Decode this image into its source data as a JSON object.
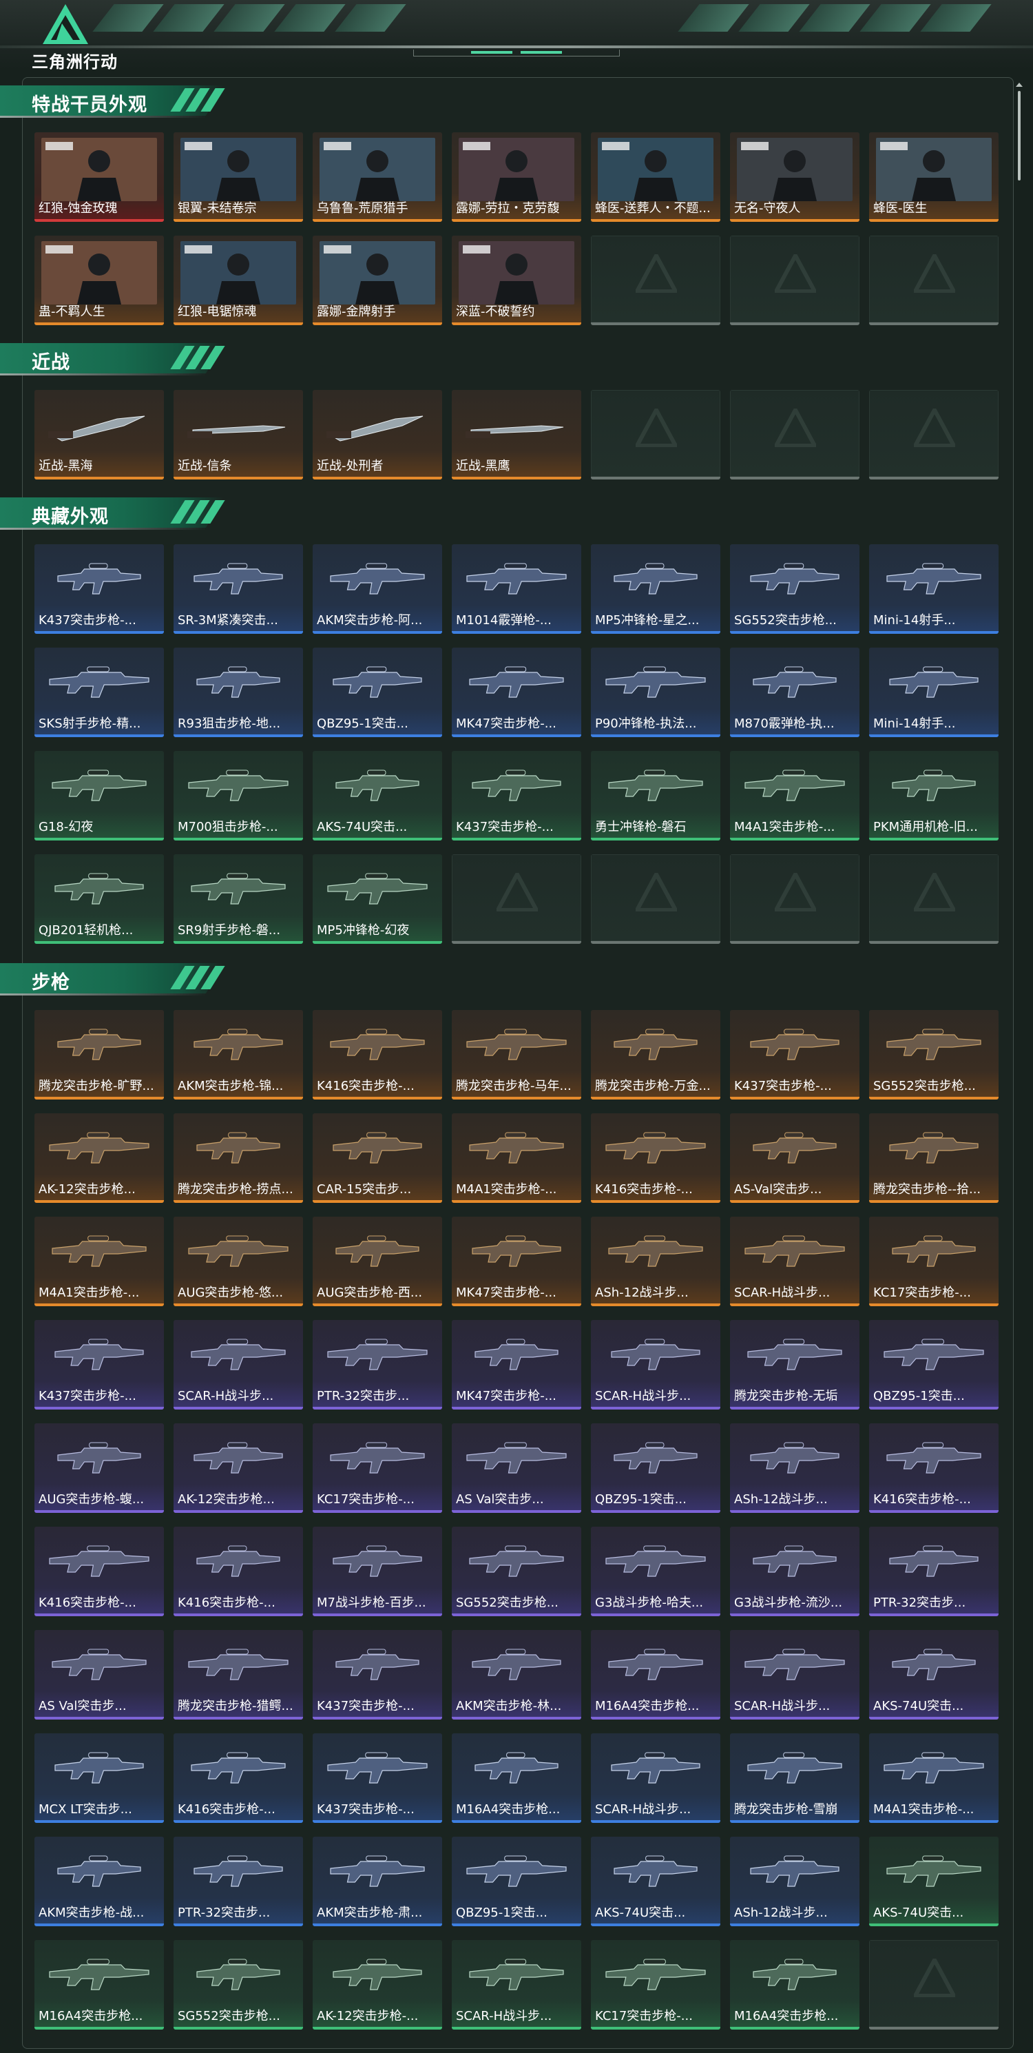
{
  "app": {
    "logo_text": "三角洲行动",
    "logo_icon": "delta-triangle-logo"
  },
  "sections": [
    {
      "title": "特战干员外观",
      "items": [
        {
          "label": "红狼-蚀金玫瑰",
          "rarity": "red",
          "kind": "portrait"
        },
        {
          "label": "银翼-未结卷宗",
          "rarity": "orange",
          "kind": "portrait"
        },
        {
          "label": "乌鲁鲁-荒原猎手",
          "rarity": "orange",
          "kind": "portrait"
        },
        {
          "label": "露娜-劳拉・克劳馥",
          "rarity": "orange",
          "kind": "portrait"
        },
        {
          "label": "蜂医-送葬人・不题...",
          "rarity": "orange",
          "kind": "portrait"
        },
        {
          "label": "无名-守夜人",
          "rarity": "orange",
          "kind": "portrait"
        },
        {
          "label": "蜂医-医生",
          "rarity": "orange",
          "kind": "portrait"
        },
        {
          "label": "蛊-不羁人生",
          "rarity": "orange",
          "kind": "portrait"
        },
        {
          "label": "红狼-电锯惊魂",
          "rarity": "orange",
          "kind": "portrait"
        },
        {
          "label": "露娜-金牌射手",
          "rarity": "orange",
          "kind": "portrait"
        },
        {
          "label": "深蓝-不破誓约",
          "rarity": "orange",
          "kind": "portrait"
        },
        {
          "label": "",
          "rarity": "empty"
        },
        {
          "label": "",
          "rarity": "empty"
        },
        {
          "label": "",
          "rarity": "empty"
        }
      ]
    },
    {
      "title": "近战",
      "items": [
        {
          "label": "近战-黑海",
          "rarity": "orange",
          "kind": "melee"
        },
        {
          "label": "近战-信条",
          "rarity": "orange",
          "kind": "melee"
        },
        {
          "label": "近战-处刑者",
          "rarity": "orange",
          "kind": "melee"
        },
        {
          "label": "近战-黑鹰",
          "rarity": "orange",
          "kind": "melee"
        },
        {
          "label": "",
          "rarity": "empty"
        },
        {
          "label": "",
          "rarity": "empty"
        },
        {
          "label": "",
          "rarity": "empty"
        }
      ]
    },
    {
      "title": "典藏外观",
      "items": [
        {
          "label": "K437突击步枪-...",
          "rarity": "blue",
          "kind": "gun"
        },
        {
          "label": "SR-3M紧凑突击...",
          "rarity": "blue",
          "kind": "gun"
        },
        {
          "label": "AKM突击步枪-阿...",
          "rarity": "blue",
          "kind": "gun"
        },
        {
          "label": "M1014霰弹枪-...",
          "rarity": "blue",
          "kind": "gun"
        },
        {
          "label": "MP5冲锋枪-星之...",
          "rarity": "blue",
          "kind": "gun"
        },
        {
          "label": "SG552突击步枪...",
          "rarity": "blue",
          "kind": "gun"
        },
        {
          "label": "Mini-14射手...",
          "rarity": "blue",
          "kind": "gun"
        },
        {
          "label": "SKS射手步枪-精...",
          "rarity": "blue",
          "kind": "gun"
        },
        {
          "label": "R93狙击步枪-地...",
          "rarity": "blue",
          "kind": "gun"
        },
        {
          "label": "QBZ95-1突击...",
          "rarity": "blue",
          "kind": "gun"
        },
        {
          "label": "MK47突击步枪-...",
          "rarity": "blue",
          "kind": "gun"
        },
        {
          "label": "P90冲锋枪-执法...",
          "rarity": "blue",
          "kind": "gun"
        },
        {
          "label": "M870霰弹枪-执...",
          "rarity": "blue",
          "kind": "gun"
        },
        {
          "label": "Mini-14射手...",
          "rarity": "blue",
          "kind": "gun"
        },
        {
          "label": "G18-幻夜",
          "rarity": "green",
          "kind": "gun"
        },
        {
          "label": "M700狙击步枪-...",
          "rarity": "green",
          "kind": "gun"
        },
        {
          "label": "AKS-74U突击...",
          "rarity": "green",
          "kind": "gun"
        },
        {
          "label": "K437突击步枪-...",
          "rarity": "green",
          "kind": "gun"
        },
        {
          "label": "勇士冲锋枪-磐石",
          "rarity": "green",
          "kind": "gun"
        },
        {
          "label": "M4A1突击步枪-...",
          "rarity": "green",
          "kind": "gun"
        },
        {
          "label": "PKM通用机枪-旧...",
          "rarity": "green",
          "kind": "gun"
        },
        {
          "label": "QJB201轻机枪...",
          "rarity": "green",
          "kind": "gun"
        },
        {
          "label": "SR9射手步枪-磐...",
          "rarity": "green",
          "kind": "gun"
        },
        {
          "label": "MP5冲锋枪-幻夜",
          "rarity": "green",
          "kind": "gun"
        },
        {
          "label": "",
          "rarity": "empty"
        },
        {
          "label": "",
          "rarity": "empty"
        },
        {
          "label": "",
          "rarity": "empty"
        },
        {
          "label": "",
          "rarity": "empty"
        }
      ]
    },
    {
      "title": "步枪",
      "items": [
        {
          "label": "腾龙突击步枪-旷野...",
          "rarity": "orange",
          "kind": "gun"
        },
        {
          "label": "AKM突击步枪-锦...",
          "rarity": "orange",
          "kind": "gun"
        },
        {
          "label": "K416突击步枪-...",
          "rarity": "orange",
          "kind": "gun"
        },
        {
          "label": "腾龙突击步枪-马年...",
          "rarity": "orange",
          "kind": "gun"
        },
        {
          "label": "腾龙突击步枪-万金...",
          "rarity": "orange",
          "kind": "gun"
        },
        {
          "label": "K437突击步枪-...",
          "rarity": "orange",
          "kind": "gun"
        },
        {
          "label": "SG552突击步枪...",
          "rarity": "orange",
          "kind": "gun"
        },
        {
          "label": "AK-12突击步枪...",
          "rarity": "orange",
          "kind": "gun"
        },
        {
          "label": "腾龙突击步枪-捞点...",
          "rarity": "orange",
          "kind": "gun"
        },
        {
          "label": "CAR-15突击步...",
          "rarity": "orange",
          "kind": "gun"
        },
        {
          "label": "M4A1突击步枪-...",
          "rarity": "orange",
          "kind": "gun"
        },
        {
          "label": "K416突击步枪-...",
          "rarity": "orange",
          "kind": "gun"
        },
        {
          "label": "AS-Val突击步...",
          "rarity": "orange",
          "kind": "gun"
        },
        {
          "label": "腾龙突击步枪--拾...",
          "rarity": "orange",
          "kind": "gun"
        },
        {
          "label": "M4A1突击步枪-...",
          "rarity": "orange",
          "kind": "gun"
        },
        {
          "label": "AUG突击步枪-悠...",
          "rarity": "orange",
          "kind": "gun"
        },
        {
          "label": "AUG突击步枪-西...",
          "rarity": "orange",
          "kind": "gun"
        },
        {
          "label": "MK47突击步枪-...",
          "rarity": "orange",
          "kind": "gun"
        },
        {
          "label": "ASh-12战斗步...",
          "rarity": "orange",
          "kind": "gun"
        },
        {
          "label": "SCAR-H战斗步...",
          "rarity": "orange",
          "kind": "gun"
        },
        {
          "label": "KC17突击步枪-...",
          "rarity": "orange",
          "kind": "gun"
        },
        {
          "label": "K437突击步枪-...",
          "rarity": "purple",
          "kind": "gun"
        },
        {
          "label": "SCAR-H战斗步...",
          "rarity": "purple",
          "kind": "gun"
        },
        {
          "label": "PTR-32突击步...",
          "rarity": "purple",
          "kind": "gun"
        },
        {
          "label": "MK47突击步枪-...",
          "rarity": "purple",
          "kind": "gun"
        },
        {
          "label": "SCAR-H战斗步...",
          "rarity": "purple",
          "kind": "gun"
        },
        {
          "label": "腾龙突击步枪-无垢",
          "rarity": "purple",
          "kind": "gun"
        },
        {
          "label": "QBZ95-1突击...",
          "rarity": "purple",
          "kind": "gun"
        },
        {
          "label": "AUG突击步枪-蝮...",
          "rarity": "purple",
          "kind": "gun"
        },
        {
          "label": "AK-12突击步枪...",
          "rarity": "purple",
          "kind": "gun"
        },
        {
          "label": "KC17突击步枪-...",
          "rarity": "purple",
          "kind": "gun"
        },
        {
          "label": "AS Val突击步...",
          "rarity": "purple",
          "kind": "gun"
        },
        {
          "label": "QBZ95-1突击...",
          "rarity": "purple",
          "kind": "gun"
        },
        {
          "label": "ASh-12战斗步...",
          "rarity": "purple",
          "kind": "gun"
        },
        {
          "label": "K416突击步枪-...",
          "rarity": "purple",
          "kind": "gun"
        },
        {
          "label": "K416突击步枪-...",
          "rarity": "purple",
          "kind": "gun"
        },
        {
          "label": "K416突击步枪-...",
          "rarity": "purple",
          "kind": "gun"
        },
        {
          "label": "M7战斗步枪-百步...",
          "rarity": "purple",
          "kind": "gun"
        },
        {
          "label": "SG552突击步枪...",
          "rarity": "purple",
          "kind": "gun"
        },
        {
          "label": "G3战斗步枪-哈夫...",
          "rarity": "purple",
          "kind": "gun"
        },
        {
          "label": "G3战斗步枪-流沙...",
          "rarity": "purple",
          "kind": "gun"
        },
        {
          "label": "PTR-32突击步...",
          "rarity": "purple",
          "kind": "gun"
        },
        {
          "label": "AS Val突击步...",
          "rarity": "purple",
          "kind": "gun"
        },
        {
          "label": "腾龙突击步枪-猎鳄...",
          "rarity": "purple",
          "kind": "gun"
        },
        {
          "label": "K437突击步枪-...",
          "rarity": "purple",
          "kind": "gun"
        },
        {
          "label": "AKM突击步枪-林...",
          "rarity": "purple",
          "kind": "gun"
        },
        {
          "label": "M16A4突击步枪...",
          "rarity": "purple",
          "kind": "gun"
        },
        {
          "label": "SCAR-H战斗步...",
          "rarity": "purple",
          "kind": "gun"
        },
        {
          "label": "AKS-74U突击...",
          "rarity": "purple",
          "kind": "gun"
        },
        {
          "label": "MCX LT突击步...",
          "rarity": "blue",
          "kind": "gun"
        },
        {
          "label": "K416突击步枪-...",
          "rarity": "blue",
          "kind": "gun"
        },
        {
          "label": "K437突击步枪-...",
          "rarity": "blue",
          "kind": "gun"
        },
        {
          "label": "M16A4突击步枪...",
          "rarity": "blue",
          "kind": "gun"
        },
        {
          "label": "SCAR-H战斗步...",
          "rarity": "blue",
          "kind": "gun"
        },
        {
          "label": "腾龙突击步枪-雪崩",
          "rarity": "blue",
          "kind": "gun"
        },
        {
          "label": "M4A1突击步枪-...",
          "rarity": "blue",
          "kind": "gun"
        },
        {
          "label": "AKM突击步枪-战...",
          "rarity": "blue",
          "kind": "gun"
        },
        {
          "label": "PTR-32突击步...",
          "rarity": "blue",
          "kind": "gun"
        },
        {
          "label": "AKM突击步枪-肃...",
          "rarity": "blue",
          "kind": "gun"
        },
        {
          "label": "QBZ95-1突击...",
          "rarity": "blue",
          "kind": "gun"
        },
        {
          "label": "AKS-74U突击...",
          "rarity": "blue",
          "kind": "gun"
        },
        {
          "label": "ASh-12战斗步...",
          "rarity": "blue",
          "kind": "gun"
        },
        {
          "label": "AKS-74U突击...",
          "rarity": "green",
          "kind": "gun"
        },
        {
          "label": "M16A4突击步枪...",
          "rarity": "green",
          "kind": "gun"
        },
        {
          "label": "SG552突击步枪...",
          "rarity": "green",
          "kind": "gun"
        },
        {
          "label": "AK-12突击步枪-...",
          "rarity": "green",
          "kind": "gun"
        },
        {
          "label": "SCAR-H战斗步...",
          "rarity": "green",
          "kind": "gun"
        },
        {
          "label": "KC17突击步枪-...",
          "rarity": "green",
          "kind": "gun"
        },
        {
          "label": "M16A4突击步枪...",
          "rarity": "green",
          "kind": "gun"
        },
        {
          "label": "",
          "rarity": "empty"
        }
      ]
    }
  ],
  "colors": {
    "accent": "#1e7c5c",
    "rarity_red": "#d23b3b",
    "rarity_orange": "#e58a2b",
    "rarity_purple": "#7c63d6",
    "rarity_blue": "#3d7fe0",
    "rarity_green": "#3fbf78"
  }
}
